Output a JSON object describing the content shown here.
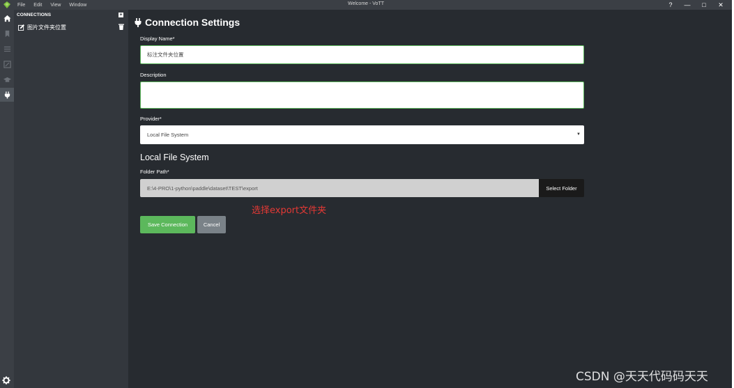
{
  "titlebar": {
    "menu": [
      "File",
      "Edit",
      "View",
      "Window"
    ],
    "title": "Welcome - VoTT",
    "help": "?",
    "minimize": "—",
    "maximize": "□",
    "close": "✕"
  },
  "sidebar": {
    "header": "CONNECTIONS",
    "add": "+",
    "items": [
      {
        "label": "图片文件夹位置"
      }
    ]
  },
  "main": {
    "title": "Connection Settings",
    "display_name_label": "Display Name*",
    "display_name_value": "标注文件夹位置",
    "description_label": "Description",
    "description_value": "",
    "provider_label": "Provider*",
    "provider_value": "Local File System",
    "section_title": "Local File System",
    "folder_path_label": "Folder Path*",
    "folder_path_value": "E:\\4-PRO\\1-python\\paddle\\dataset\\TEST\\export",
    "select_folder": "Select Folder",
    "annotation": "选择export文件夹",
    "save": "Save Connection",
    "cancel": "Cancel"
  },
  "watermark": "CSDN @天天代码码天天",
  "colors": {
    "accent": "#5cb85c",
    "background": "#272b30",
    "sidebar": "#33373d",
    "annotation": "#e53935"
  },
  "icons": [
    "app-logo-icon",
    "home-icon",
    "bookmark-icon",
    "list-icon",
    "edit-tags-icon",
    "export-icon",
    "plug-icon",
    "settings-icon",
    "edit-icon",
    "trash-icon"
  ]
}
